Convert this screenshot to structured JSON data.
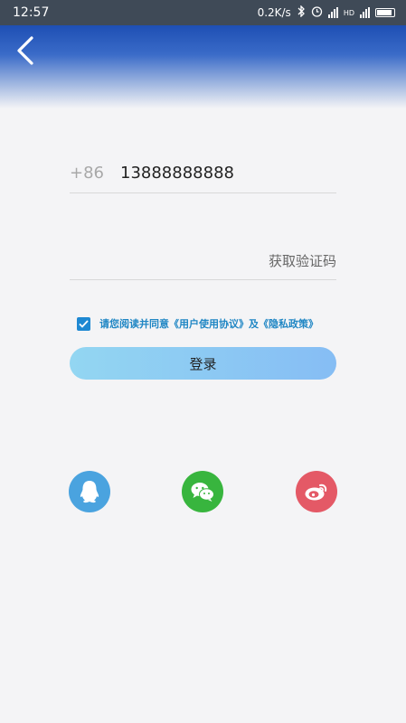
{
  "status_bar": {
    "time": "12:57",
    "network_speed": "0.2K/s",
    "hd_label": "HD",
    "icons": [
      "bluetooth-icon",
      "alarm-icon",
      "signal-icon",
      "battery-icon"
    ]
  },
  "header": {
    "back_icon": "chevron-left-icon"
  },
  "form": {
    "country_code": "+86",
    "phone_value": "13888888888",
    "code_placeholder": "",
    "get_code_label": "获取验证码",
    "agree_text": "请您阅读并同意《用户使用协议》及《隐私政策》",
    "agree_checked": true,
    "login_label": "登录"
  },
  "social": [
    {
      "name": "qq",
      "icon": "qq-icon",
      "color": "#4aa3df"
    },
    {
      "name": "wechat",
      "icon": "wechat-icon",
      "color": "#38b53e"
    },
    {
      "name": "weibo",
      "icon": "weibo-icon",
      "color": "#e45966"
    }
  ],
  "colors": {
    "header_blue": "#1e4fb4",
    "accent": "#1e88d2",
    "login_gradient_start": "#93d6f2",
    "login_gradient_end": "#86bdf4"
  }
}
